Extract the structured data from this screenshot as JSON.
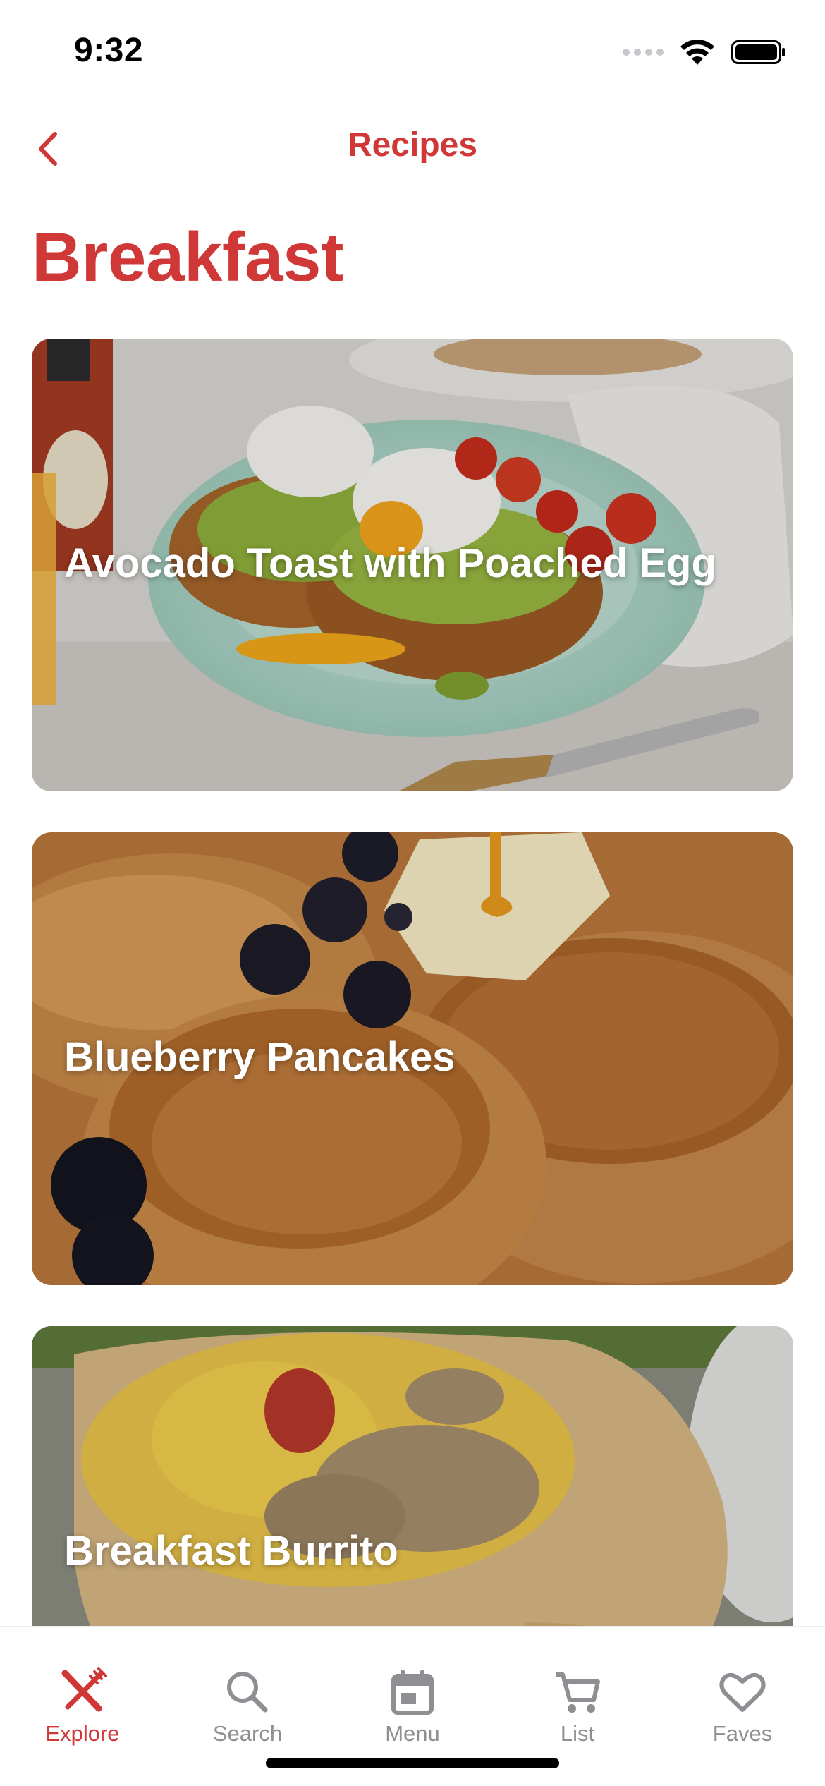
{
  "status_bar": {
    "time": "9:32"
  },
  "nav": {
    "back_icon": "chevron-left-icon",
    "title": "Recipes"
  },
  "page": {
    "title": "Breakfast"
  },
  "recipes": [
    {
      "title": "Avocado Toast with Poached Egg"
    },
    {
      "title": "Blueberry Pancakes"
    },
    {
      "title": "Breakfast Burrito"
    }
  ],
  "tabs": [
    {
      "label": "Explore",
      "icon": "fork-knife-icon",
      "active": true
    },
    {
      "label": "Search",
      "icon": "search-icon",
      "active": false
    },
    {
      "label": "Menu",
      "icon": "calendar-icon",
      "active": false
    },
    {
      "label": "List",
      "icon": "cart-icon",
      "active": false
    },
    {
      "label": "Faves",
      "icon": "heart-icon",
      "active": false
    }
  ],
  "colors": {
    "accent": "#d03838",
    "inactive": "#8e8e93"
  }
}
